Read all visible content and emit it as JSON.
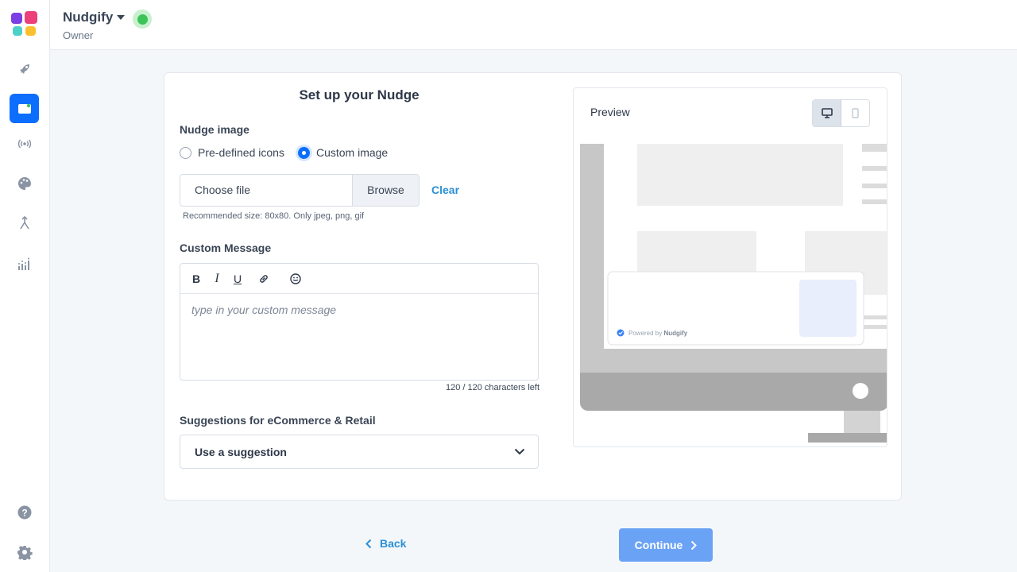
{
  "app": {
    "brand": "Nudgify",
    "role": "Owner"
  },
  "sidebar": {
    "items": [
      {
        "name": "launch",
        "icon": "rocket-icon"
      },
      {
        "name": "nudges",
        "icon": "browser-window-icon",
        "active": true
      },
      {
        "name": "broadcast",
        "icon": "broadcast-icon"
      },
      {
        "name": "design",
        "icon": "palette-icon"
      },
      {
        "name": "integrations",
        "icon": "merge-icon"
      },
      {
        "name": "analytics",
        "icon": "chart-icon"
      }
    ],
    "bottom": [
      {
        "name": "help",
        "icon": "help-icon"
      },
      {
        "name": "settings",
        "icon": "gear-icon"
      }
    ],
    "accent": "#0d6efd"
  },
  "form": {
    "title": "Set up your Nudge",
    "image_section": {
      "label": "Nudge image",
      "options": [
        "Pre-defined icons",
        "Custom image"
      ],
      "selected": "Custom image",
      "file_placeholder": "Choose file",
      "browse_label": "Browse",
      "clear_label": "Clear",
      "hint": "Recommended size: 80x80. Only jpeg, png, gif"
    },
    "message_section": {
      "label": "Custom Message",
      "toolbar": [
        "B",
        "I",
        "U"
      ],
      "placeholder": "type in your custom message",
      "char_count": "120 / 120 characters left"
    },
    "suggestions": {
      "label": "Suggestions for eCommerce & Retail",
      "selected": "Use a suggestion"
    }
  },
  "preview": {
    "label": "Preview",
    "mode": "desktop",
    "powered_by": "Powered by",
    "powered_brand": "Nudgify"
  },
  "footer": {
    "back_label": "Back",
    "continue_label": "Continue",
    "continue_color": "#6aa2f5"
  }
}
